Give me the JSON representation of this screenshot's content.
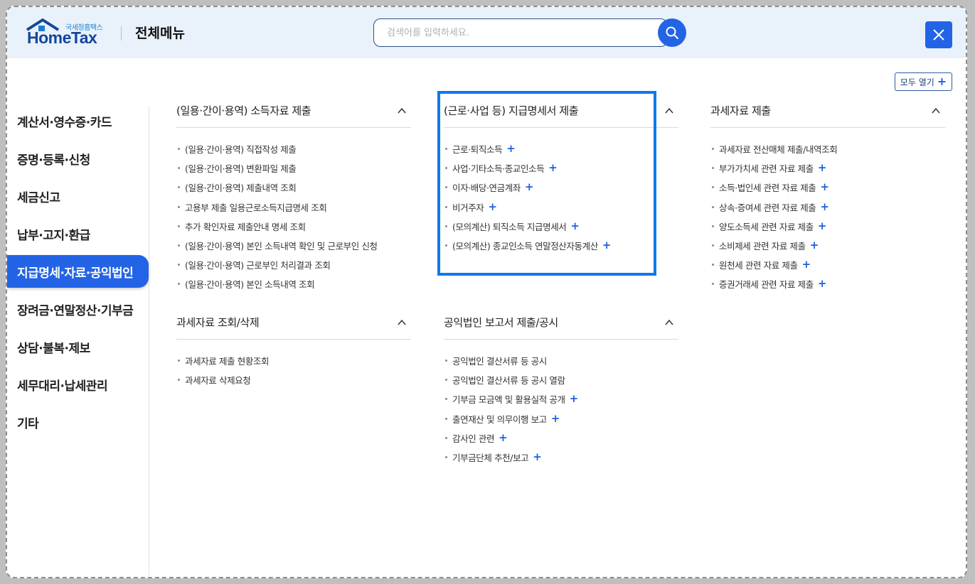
{
  "header": {
    "logo_sub": "국세청홈택스",
    "logo_brand": "HomeTax",
    "title": "전체메뉴",
    "search_placeholder": "검색어를 입력하세요.",
    "open_all_label": "모두 열기",
    "open_all_plus": "+"
  },
  "sidebar": {
    "items": [
      {
        "label": "계산서·영수증·카드"
      },
      {
        "label": "증명·등록·신청"
      },
      {
        "label": "세금신고"
      },
      {
        "label": "납부·고지·환급"
      },
      {
        "label": "지급명세·자료·공익법인",
        "active": true
      },
      {
        "label": "장려금·연말정산·기부금"
      },
      {
        "label": "상담·불복·제보"
      },
      {
        "label": "세무대리·납세관리"
      },
      {
        "label": "기타"
      }
    ]
  },
  "sections": [
    {
      "title": "(일용·간이·용역) 소득자료 제출",
      "items": [
        {
          "label": "(일용·간이·용역) 직접작성 제출",
          "plus": ""
        },
        {
          "label": "(일용·간이·용역) 변환파일 제출",
          "plus": ""
        },
        {
          "label": "(일용·간이·용역) 제출내역 조회",
          "plus": ""
        },
        {
          "label": "고용부 제출 일용근로소득지급명세 조회",
          "plus": ""
        },
        {
          "label": "추가 확인자료 제출안내 명세 조회",
          "plus": ""
        },
        {
          "label": "(일용·간이·용역) 본인 소득내역 확인 및 근로부인 신청",
          "plus": ""
        },
        {
          "label": "(일용·간이·용역) 근로부인 처리결과 조회",
          "plus": ""
        },
        {
          "label": "(일용·간이·용역) 본인 소득내역 조회",
          "plus": ""
        }
      ]
    },
    {
      "title": "(근로·사업 등) 지급명세서 제출",
      "items": [
        {
          "label": "근로·퇴직소득",
          "plus": "+"
        },
        {
          "label": "사업·기타소득·종교인소득",
          "plus": "+"
        },
        {
          "label": "이자·배당·연금계좌",
          "plus": "+"
        },
        {
          "label": "비거주자",
          "plus": "+"
        },
        {
          "label": "(모의계산) 퇴직소득 지급명세서",
          "plus": "+"
        },
        {
          "label": "(모의계산) 종교인소득 연말정산자동계산",
          "plus": "+"
        }
      ]
    },
    {
      "title": "과세자료 제출",
      "items": [
        {
          "label": "과세자료 전산매체 제출/내역조회",
          "plus": ""
        },
        {
          "label": "부가가치세 관련 자료 제출",
          "plus": "+"
        },
        {
          "label": "소득·법인세 관련 자료 제출",
          "plus": "+"
        },
        {
          "label": "상속·증여세 관련 자료 제출",
          "plus": "+"
        },
        {
          "label": "양도소득세 관련 자료 제출",
          "plus": "+"
        },
        {
          "label": "소비제세 관련 자료 제출",
          "plus": "+"
        },
        {
          "label": "원천세 관련 자료 제출",
          "plus": "+"
        },
        {
          "label": "증권거래세 관련 자료 제출",
          "plus": "+"
        }
      ]
    },
    {
      "title": "과세자료 조회/삭제",
      "items": [
        {
          "label": "과세자료 제출 현황조회",
          "plus": ""
        },
        {
          "label": "과세자료 삭제요청",
          "plus": ""
        }
      ]
    },
    {
      "title": "공익법인 보고서 제출/공시",
      "items": [
        {
          "label": "공익법인 결산서류 등 공시",
          "plus": ""
        },
        {
          "label": "공익법인 결산서류 등 공시 열람",
          "plus": ""
        },
        {
          "label": "기부금 모금액 및 활용실적 공개",
          "plus": "+"
        },
        {
          "label": "출연재산 및 의무이행 보고",
          "plus": "+"
        },
        {
          "label": "감사인 관련",
          "plus": "+"
        },
        {
          "label": "기부금단체 추천/보고",
          "plus": "+"
        }
      ]
    }
  ],
  "colors": {
    "accent": "#2264e5",
    "header_bg": "#e9f1fa",
    "highlight_border": "#1177ee"
  }
}
